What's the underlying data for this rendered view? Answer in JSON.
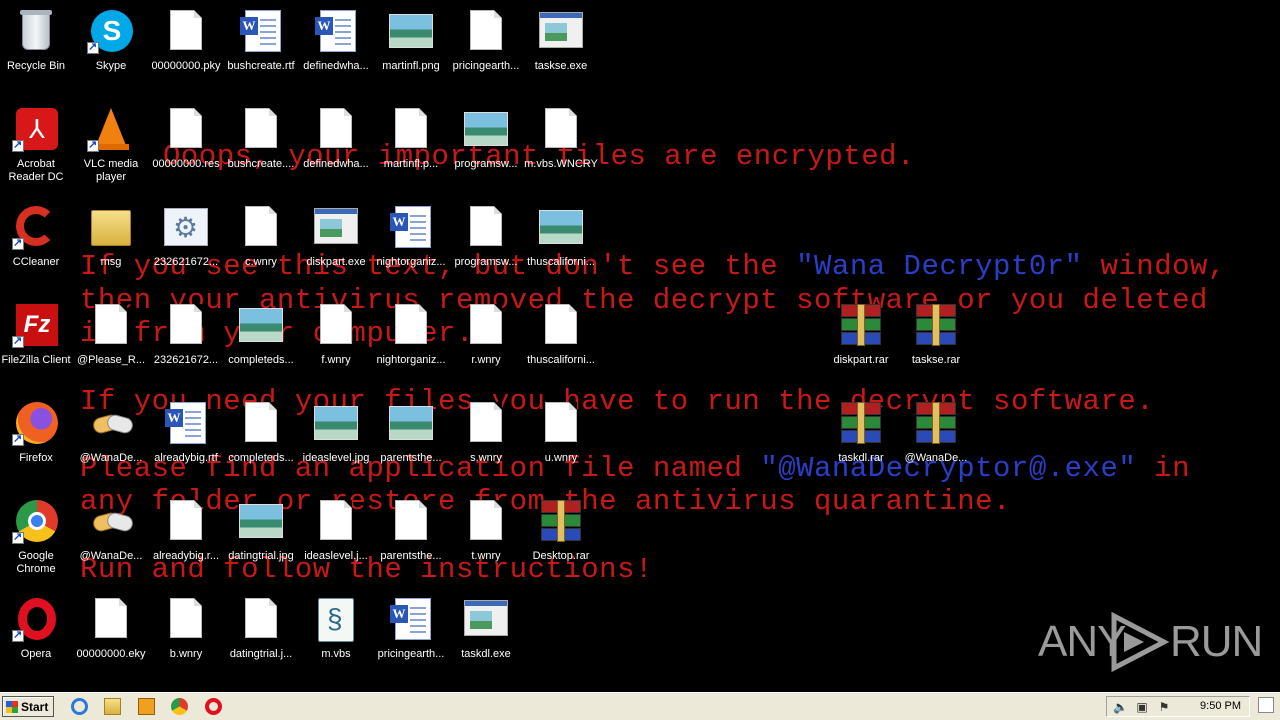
{
  "ransom_note": {
    "line1": "Ooops, your important files are encrypted.",
    "line2_pre": "If you see this text, but don't see the ",
    "line2_highlight": "\"Wana Decrypt0r\"",
    "line2_post": " window,",
    "line3": "then your antivirus removed the decrypt software or you deleted",
    "line4": "it from your computer.",
    "line5": "If you need your files you have to run the decrypt software.",
    "line6_pre": "Please find an application file named ",
    "line6_highlight": "\"@WanaDecryptor@.exe\"",
    "line6_post": " in",
    "line7": "any folder or restore from the antivirus quarantine.",
    "line8": "Run and follow the instructions!",
    "text_color": "#c81818",
    "highlight_color": "#2a3ec8"
  },
  "desktop_icons": [
    {
      "label": "Recycle Bin",
      "icon": "recycle-bin-icon"
    },
    {
      "label": "Skype",
      "icon": "skype-icon"
    },
    {
      "label": "00000000.pky",
      "icon": "file-icon"
    },
    {
      "label": "bushcreate.rtf",
      "icon": "word-doc-icon"
    },
    {
      "label": "definedwha...",
      "icon": "word-doc-icon"
    },
    {
      "label": "martinfl.png",
      "icon": "image-icon"
    },
    {
      "label": "pricingearth...",
      "icon": "file-icon"
    },
    {
      "label": "taskse.exe",
      "icon": "exe-icon"
    },
    {
      "label": "Acrobat Reader DC",
      "icon": "acrobat-icon"
    },
    {
      "label": "VLC media player",
      "icon": "vlc-icon"
    },
    {
      "label": "00000000.res",
      "icon": "file-icon"
    },
    {
      "label": "bushcreate....",
      "icon": "file-icon"
    },
    {
      "label": "definedwha...",
      "icon": "file-icon"
    },
    {
      "label": "martinfl.p...",
      "icon": "file-icon"
    },
    {
      "label": "programsw...",
      "icon": "image-icon"
    },
    {
      "label": "m.vbs.WNCRY",
      "icon": "file-icon"
    },
    {
      "label": "CCleaner",
      "icon": "ccleaner-icon"
    },
    {
      "label": "msg",
      "icon": "folder-icon"
    },
    {
      "label": "232621672...",
      "icon": "gears-icon"
    },
    {
      "label": "c.wnry",
      "icon": "file-icon"
    },
    {
      "label": "diskpart.exe",
      "icon": "exe-icon"
    },
    {
      "label": "nightorganiz...",
      "icon": "word-doc-icon"
    },
    {
      "label": "programsw...",
      "icon": "file-icon"
    },
    {
      "label": "thuscaliforni...",
      "icon": "image-icon"
    },
    {
      "label": "FileZilla Client",
      "icon": "filezilla-icon"
    },
    {
      "label": "@Please_R...",
      "icon": "file-icon"
    },
    {
      "label": "232621672...",
      "icon": "file-icon"
    },
    {
      "label": "completeds...",
      "icon": "image-icon"
    },
    {
      "label": "f.wnry",
      "icon": "file-icon"
    },
    {
      "label": "nightorganiz...",
      "icon": "file-icon"
    },
    {
      "label": "r.wnry",
      "icon": "file-icon"
    },
    {
      "label": "thuscaliforni...",
      "icon": "file-icon"
    },
    {
      "label": "diskpart.rar",
      "icon": "rar-icon"
    },
    {
      "label": "taskse.rar",
      "icon": "rar-icon"
    },
    {
      "label": "Firefox",
      "icon": "firefox-icon"
    },
    {
      "label": "@WanaDe...",
      "icon": "handshake-icon"
    },
    {
      "label": "alreadybig.rtf",
      "icon": "word-doc-icon"
    },
    {
      "label": "completeds...",
      "icon": "file-icon"
    },
    {
      "label": "ideaslevel.jpg",
      "icon": "image-icon"
    },
    {
      "label": "parentsthe...",
      "icon": "image-icon"
    },
    {
      "label": "s.wnry",
      "icon": "file-icon"
    },
    {
      "label": "u.wnry",
      "icon": "file-icon"
    },
    {
      "label": "taskdl.rar",
      "icon": "rar-icon"
    },
    {
      "label": "@WanaDe...",
      "icon": "rar-icon"
    },
    {
      "label": "Google Chrome",
      "icon": "chrome-icon"
    },
    {
      "label": "@WanaDe...",
      "icon": "handshake-icon"
    },
    {
      "label": "alreadybig.r...",
      "icon": "file-icon"
    },
    {
      "label": "datingtrial.jpg",
      "icon": "image-icon"
    },
    {
      "label": "ideaslevel.j...",
      "icon": "file-icon"
    },
    {
      "label": "parentsthe...",
      "icon": "file-icon"
    },
    {
      "label": "t.wnry",
      "icon": "file-icon"
    },
    {
      "label": "Desktop.rar",
      "icon": "rar-icon"
    },
    {
      "label": "Opera",
      "icon": "opera-icon"
    },
    {
      "label": "00000000.eky",
      "icon": "file-icon"
    },
    {
      "label": "b.wnry",
      "icon": "file-icon"
    },
    {
      "label": "datingtrial.j...",
      "icon": "file-icon"
    },
    {
      "label": "m.vbs",
      "icon": "script-icon"
    },
    {
      "label": "pricingearth...",
      "icon": "word-doc-icon"
    },
    {
      "label": "taskdl.exe",
      "icon": "exe-icon"
    }
  ],
  "taskbar": {
    "start_label": "Start",
    "quick_launch": [
      "ie-icon",
      "explorer-icon",
      "media-player-icon",
      "chrome-icon",
      "opera-icon"
    ],
    "tray_icons": [
      "volume-icon",
      "network-icon",
      "flag-icon"
    ],
    "clock": "9:50 PM"
  },
  "watermark": {
    "left": "ANY",
    "right": "RUN"
  }
}
